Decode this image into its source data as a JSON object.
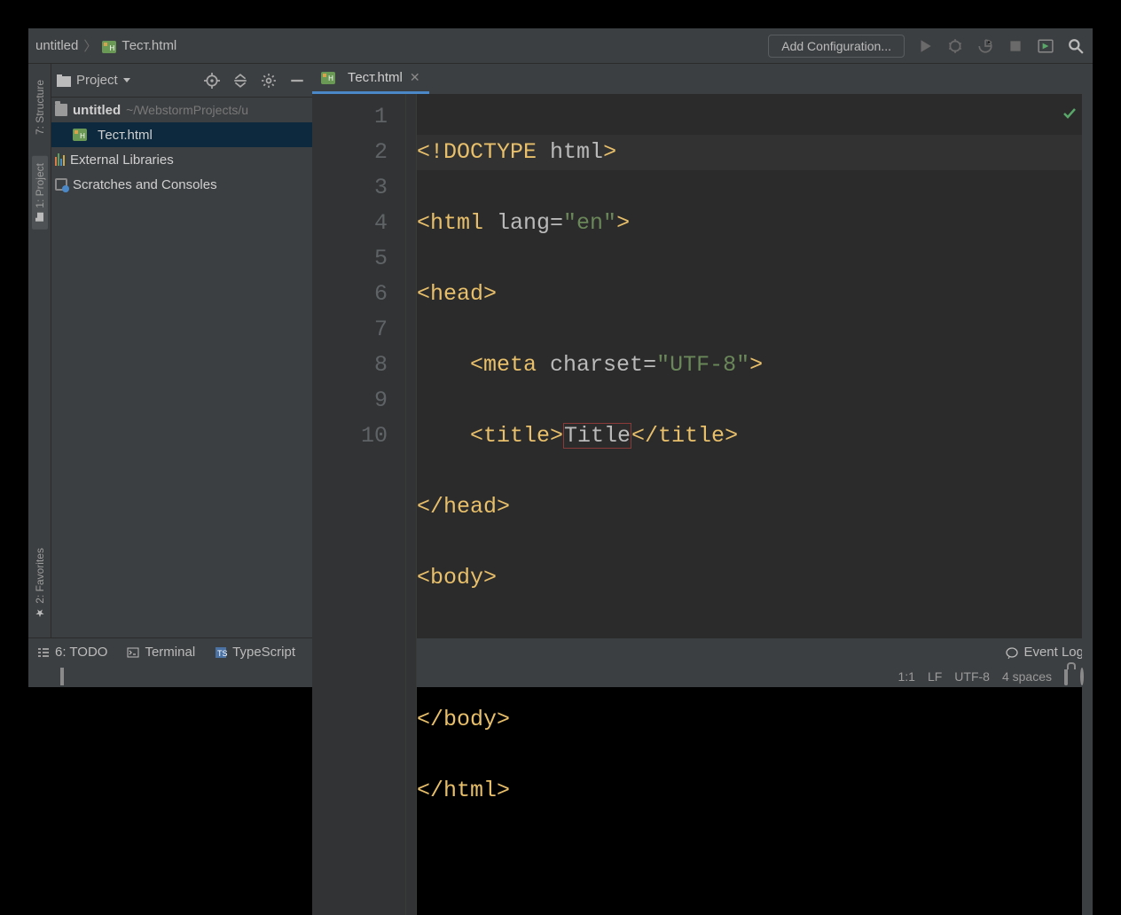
{
  "breadcrumbs": {
    "project": "untitled",
    "file": "Тест.html"
  },
  "topbar": {
    "add_config": "Add Configuration..."
  },
  "leftstrip": {
    "structure": "7: Structure",
    "project": "1: Project",
    "favorites": "2: Favorites"
  },
  "sidebar": {
    "title": "Project",
    "root": {
      "name": "untitled",
      "path": "~/WebstormProjects/u"
    },
    "file": "Тест.html",
    "external": "External Libraries",
    "scratches": "Scratches and Consoles"
  },
  "tab": {
    "name": "Тест.html"
  },
  "gutter": [
    "1",
    "2",
    "3",
    "4",
    "5",
    "6",
    "7",
    "8",
    "9",
    "10"
  ],
  "code": {
    "l1a": "<!",
    "l1b": "DOCTYPE ",
    "l1h": "html",
    "l1c": ">",
    "l2a": "<html ",
    "l2b": "lang",
    "l2c": "=",
    "l2d": "\"en\"",
    "l2e": ">",
    "l3": "<head>",
    "l4a": "    <meta ",
    "l4b": "charset",
    "l4c": "=",
    "l4d": "\"UTF-8\"",
    "l4e": ">",
    "l5a": "    <title>",
    "l5b": "Title",
    "l5c": "</title>",
    "l6": "</head>",
    "l7": "<body>",
    "l8": "",
    "l9": "</body>",
    "l10": "</html>"
  },
  "tools": {
    "todo": "6: TODO",
    "terminal": "Terminal",
    "typescript": "TypeScript",
    "eventlog": "Event Log"
  },
  "status": {
    "pos": "1:1",
    "sep": "LF",
    "enc": "UTF-8",
    "indent": "4 spaces"
  }
}
